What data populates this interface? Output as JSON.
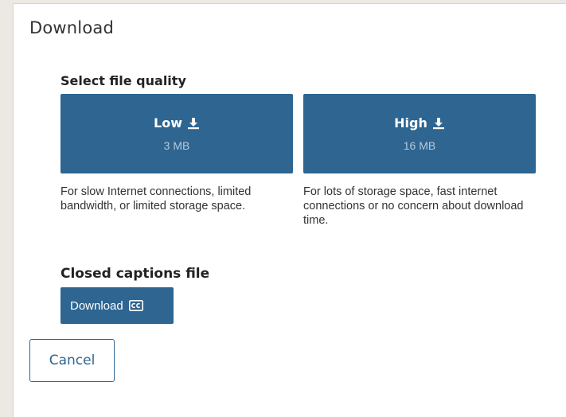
{
  "dialog": {
    "title": "Download"
  },
  "quality": {
    "heading": "Select file quality",
    "options": [
      {
        "label": "Low",
        "size": "3 MB",
        "description": "For slow Internet connections, limited bandwidth, or limited storage space.",
        "icon": "download-icon"
      },
      {
        "label": "High",
        "size": "16 MB",
        "description": "For lots of storage space, fast internet connections or no concern about download time.",
        "icon": "download-icon"
      }
    ]
  },
  "captions": {
    "heading": "Closed captions file",
    "button_label": "Download",
    "icon": "closed-captions-icon"
  },
  "actions": {
    "cancel_label": "Cancel"
  },
  "colors": {
    "accent": "#2e6591",
    "size_text": "#b7c9da",
    "background": "#ece9e4"
  }
}
